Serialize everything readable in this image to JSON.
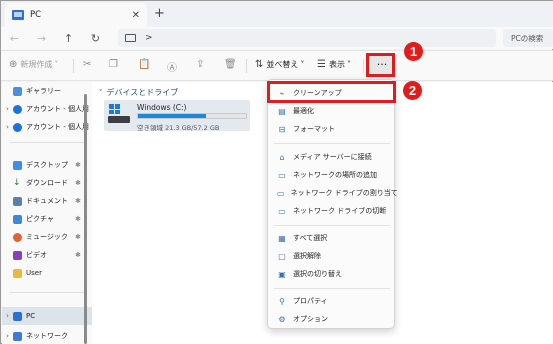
{
  "window": {
    "tab_title": "PC",
    "new_tab_symbol": "+",
    "close_symbol": "✕"
  },
  "addressbar": {
    "path_separator": ">",
    "search_placeholder": "PCの検索"
  },
  "toolbar": {
    "new_label": "新規作成",
    "sort_label": "並べ替え",
    "view_label": "表示",
    "more_label": "···"
  },
  "sidebar": {
    "items": [
      {
        "label": "ギャラリー",
        "icon": "gallery-icon"
      },
      {
        "label": "アカウント - 個人用",
        "icon": "cloud-icon"
      },
      {
        "label": "アカウント - 個人用",
        "icon": "cloud-icon"
      },
      {
        "label": "デスクトップ",
        "icon": "desktop-icon"
      },
      {
        "label": "ダウンロード",
        "icon": "download-icon"
      },
      {
        "label": "ドキュメント",
        "icon": "document-icon"
      },
      {
        "label": "ピクチャ",
        "icon": "pictures-icon"
      },
      {
        "label": "ミュージック",
        "icon": "music-icon"
      },
      {
        "label": "ビデオ",
        "icon": "video-icon"
      },
      {
        "label": "User",
        "icon": "folder-icon"
      },
      {
        "label": "PC",
        "icon": "pc-icon"
      },
      {
        "label": "ネットワーク",
        "icon": "network-icon"
      }
    ]
  },
  "main": {
    "group_title": "デバイスとドライブ",
    "drive": {
      "name": "Windows (C:)",
      "free_text": "空き領域 21.3 GB/57.2 GB",
      "used_fraction": 0.63
    }
  },
  "context_menu": {
    "items": [
      {
        "label": "クリーンアップ",
        "icon": "broom-icon"
      },
      {
        "label": "最適化",
        "icon": "optimize-icon"
      },
      {
        "label": "フォーマット",
        "icon": "format-icon"
      },
      {
        "label": "メディア サーバーに接続",
        "icon": "media-server-icon"
      },
      {
        "label": "ネットワークの場所の追加",
        "icon": "network-location-icon"
      },
      {
        "label": "ネットワーク ドライブの割り当て",
        "icon": "map-drive-icon"
      },
      {
        "label": "ネットワーク ドライブの切断",
        "icon": "disconnect-drive-icon"
      },
      {
        "label": "すべて選択",
        "icon": "select-all-icon"
      },
      {
        "label": "選択解除",
        "icon": "select-none-icon"
      },
      {
        "label": "選択の切り替え",
        "icon": "invert-selection-icon"
      },
      {
        "label": "プロパティ",
        "icon": "properties-icon"
      },
      {
        "label": "オプション",
        "icon": "options-icon"
      }
    ]
  },
  "annotations": {
    "badge1": "1",
    "badge2": "2",
    "color": "#e21b1b"
  }
}
